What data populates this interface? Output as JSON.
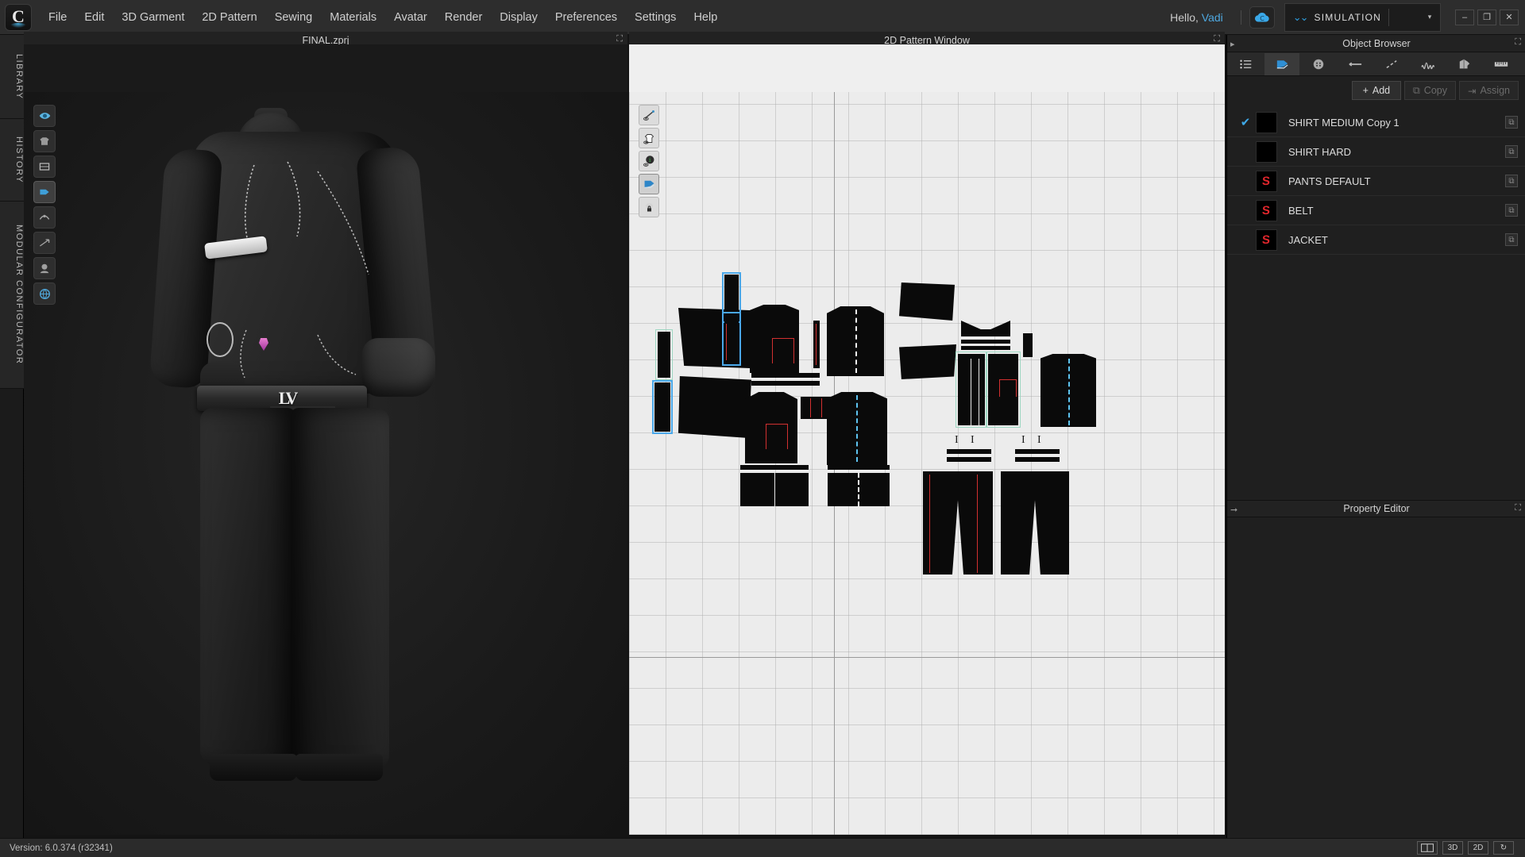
{
  "app": {
    "logo_icon": "clo-c-logo-icon",
    "version": "Version: 6.0.374 (r32341)"
  },
  "menu": {
    "items": [
      {
        "label": "File"
      },
      {
        "label": "Edit"
      },
      {
        "label": "3D Garment"
      },
      {
        "label": "2D Pattern"
      },
      {
        "label": "Sewing"
      },
      {
        "label": "Materials"
      },
      {
        "label": "Avatar"
      },
      {
        "label": "Render"
      },
      {
        "label": "Display"
      },
      {
        "label": "Preferences"
      },
      {
        "label": "Settings"
      },
      {
        "label": "Help"
      }
    ],
    "greeting_prefix": "Hello, ",
    "user_name": "Vadi",
    "cloud_icon": "clo-cloud-icon",
    "mode_label": "SIMULATION",
    "mode_chevron_icon": "double-chevron-down-icon",
    "mode_dropdown_icon": "caret-down-icon",
    "window_minimize": "–",
    "window_restore": "❐",
    "window_close": "✕"
  },
  "left_rail": {
    "tabs": [
      {
        "label": "LIBRARY"
      },
      {
        "label": "HISTORY"
      },
      {
        "label": "MODULAR CONFIGURATOR"
      }
    ]
  },
  "viewport3d": {
    "title": "FINAL.zprj",
    "expand_icon": "expand-window-icon",
    "palette": [
      {
        "name": "show-avatar-icon"
      },
      {
        "name": "show-garment-icon"
      },
      {
        "name": "show-pattern-icon"
      },
      {
        "name": "show-texture-icon"
      },
      {
        "name": "show-trim-icon"
      },
      {
        "name": "show-gizmo-icon"
      },
      {
        "name": "show-head-icon"
      },
      {
        "name": "show-environment-icon"
      }
    ]
  },
  "pattern2d": {
    "title": "2D Pattern Window",
    "expand_icon": "expand-window-icon",
    "palette": [
      {
        "name": "show-stitch-icon"
      },
      {
        "name": "show-garment-outline-icon"
      },
      {
        "name": "show-info-icon"
      },
      {
        "name": "show-fabric-icon"
      },
      {
        "name": "lock-pattern-icon"
      }
    ]
  },
  "toolbar_3d": {
    "row1": [
      {
        "name": "simulate-icon",
        "group": 0
      },
      {
        "name": "transform-move-icon",
        "group": 1,
        "active": true
      },
      {
        "name": "box-select-icon",
        "group": 1
      },
      {
        "name": "pattern-select-icon",
        "group": 2
      },
      {
        "name": "pin-point-icon",
        "group": 2
      },
      {
        "name": "curve-pin-icon",
        "group": 2
      },
      {
        "name": "fold-arrangement-icon",
        "group": 2
      },
      {
        "name": "segment-sew-icon",
        "group": 3
      },
      {
        "name": "free-sew-icon",
        "group": 3
      },
      {
        "name": "fold-line-icon",
        "group": 4
      },
      {
        "name": "arrange-fold-icon",
        "group": 4
      },
      {
        "name": "zipper-icon",
        "group": 4
      },
      {
        "name": "avatar-size-icon",
        "group": 4
      },
      {
        "name": "measure-tape-icon",
        "group": 5
      },
      {
        "name": "circumference-icon",
        "group": 5
      },
      {
        "name": "layer-order-icon",
        "group": 6
      },
      {
        "name": "expand-more-icon",
        "group": 6
      }
    ],
    "row2": [
      {
        "name": "walking-avatar-icon",
        "group": 0
      },
      {
        "name": "pressure-map-icon",
        "group": 1
      },
      {
        "name": "fitting-map-icon",
        "group": 1
      },
      {
        "name": "trim-place-icon",
        "group": 2
      },
      {
        "name": "button-place-icon",
        "group": 2
      },
      {
        "name": "texture-paint-icon",
        "group": 3
      },
      {
        "name": "graphic-place-icon",
        "group": 3
      },
      {
        "name": "checker-texture-icon",
        "group": 3
      }
    ]
  },
  "toolbar_2d": {
    "row1": [
      {
        "name": "edit-pattern-icon",
        "group": 0,
        "active": true
      },
      {
        "name": "edit-curvature-icon",
        "group": 0
      },
      {
        "name": "edit-curve-point-icon",
        "group": 0
      },
      {
        "name": "polygon-select-icon",
        "group": 0
      },
      {
        "name": "rectangle-pattern-icon",
        "group": 1
      },
      {
        "name": "trace-pattern-icon",
        "group": 1
      },
      {
        "name": "internal-polygon-icon",
        "group": 1
      },
      {
        "name": "internal-line-icon",
        "group": 1
      },
      {
        "name": "dart-icon",
        "group": 1
      },
      {
        "name": "pleat-shape-icon",
        "group": 1
      },
      {
        "name": "seam-allowance-icon",
        "group": 2
      },
      {
        "name": "grading-icon",
        "group": 3
      },
      {
        "name": "measure-pattern-icon",
        "group": 3
      },
      {
        "name": "text-tool-icon",
        "group": 4
      },
      {
        "name": "annotation-text-icon",
        "group": 4
      },
      {
        "name": "flatten-icon",
        "group": 5
      },
      {
        "name": "baseline-icon",
        "group": 6
      },
      {
        "name": "avatar-ref-icon",
        "group": 6
      }
    ],
    "row2": [
      {
        "name": "sew-segment-icon",
        "group": 0
      },
      {
        "name": "free-sew-2d-icon",
        "group": 0
      },
      {
        "name": "check-sewing-icon",
        "group": 0
      },
      {
        "name": "copy-sew-icon",
        "group": 1
      },
      {
        "name": "elastic-icon",
        "group": 1
      },
      {
        "name": "topstitch-icon",
        "group": 1
      },
      {
        "name": "puckering-icon",
        "group": 2
      },
      {
        "name": "trim-2d-icon",
        "group": 2
      },
      {
        "name": "button-2d-icon",
        "group": 2
      },
      {
        "name": "buttonhole-icon",
        "group": 2
      },
      {
        "name": "zipper-2d-icon",
        "group": 3
      },
      {
        "name": "ruler-2d-icon",
        "group": 3
      },
      {
        "name": "grain-line-icon",
        "group": 3
      },
      {
        "name": "pattern-info-icon",
        "group": 4
      }
    ]
  },
  "object_browser": {
    "title": "Object Browser",
    "expand_icon": "expand-window-icon",
    "tabs": [
      {
        "name": "list-view-icon",
        "selected": false
      },
      {
        "name": "fabric-icon",
        "selected": true
      },
      {
        "name": "button-icon",
        "selected": false
      },
      {
        "name": "zipper-bar-icon",
        "selected": false
      },
      {
        "name": "topstitch-icon",
        "selected": false
      },
      {
        "name": "elastic-wave-icon",
        "selected": false
      },
      {
        "name": "fold-fabric-icon",
        "selected": false
      },
      {
        "name": "tape-measure-icon",
        "selected": false
      }
    ],
    "actions": {
      "add_label": "Add",
      "add_icon": "plus-icon",
      "copy_label": "Copy",
      "copy_icon": "copy-icon",
      "assign_label": "Assign",
      "assign_icon": "assign-icon"
    },
    "items": [
      {
        "name": "SHIRT MEDIUM Copy 1",
        "checked": true,
        "thumb": "black-swatch",
        "row_icon": "duplicate-icon"
      },
      {
        "name": "SHIRT HARD",
        "checked": false,
        "thumb": "black-swatch",
        "row_icon": "duplicate-icon"
      },
      {
        "name": "PANTS DEFAULT",
        "checked": false,
        "thumb": "substance-logo",
        "row_icon": "duplicate-icon"
      },
      {
        "name": "BELT",
        "checked": false,
        "thumb": "substance-logo",
        "row_icon": "duplicate-icon"
      },
      {
        "name": "JACKET",
        "checked": false,
        "thumb": "substance-logo",
        "row_icon": "duplicate-icon"
      }
    ],
    "check_glyph": "✔"
  },
  "property_editor": {
    "title": "Property Editor",
    "collapse_icon": "arrow-right-icon",
    "expand_icon": "expand-window-icon"
  },
  "status_bar": {
    "buttons": [
      {
        "name": "split-view-button",
        "label": ""
      },
      {
        "name": "view-3d-button",
        "label": "3D"
      },
      {
        "name": "view-2d-button",
        "label": "2D"
      },
      {
        "name": "reset-view-button",
        "label": "↻"
      }
    ]
  },
  "colors": {
    "accent": "#3fa9e8",
    "menu_bg": "#2d2d2d",
    "panel_bg": "#1f1f1f",
    "canvas_2d_bg": "#ececec",
    "substance_red": "#e0262c",
    "selection_blue": "#4aa8ea",
    "seam_green": "#9fd9c4",
    "line_red": "#d23030"
  }
}
